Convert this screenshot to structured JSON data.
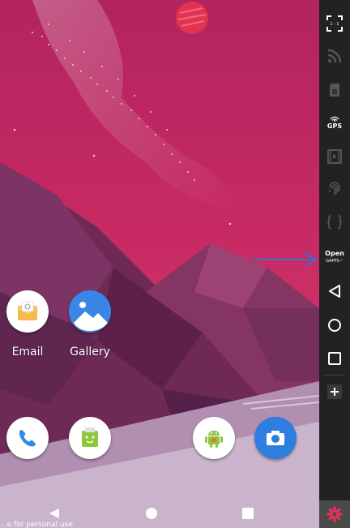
{
  "home": {
    "apps": [
      {
        "name": "Email",
        "icon": "email-envelope-icon"
      },
      {
        "name": "Gallery",
        "icon": "gallery-mountain-icon"
      }
    ],
    "dock": [
      {
        "icon": "phone-icon"
      },
      {
        "icon": "messaging-icon"
      },
      {
        "icon": "android-icon"
      },
      {
        "icon": "camera-icon"
      }
    ]
  },
  "navbar": {
    "buttons": [
      "back-icon",
      "home-icon",
      "recents-icon"
    ]
  },
  "watermark": "...e for personal use",
  "sidebar": {
    "fullscreen_label": "1 : 1",
    "gps_label": "GPS",
    "opengapps_label": "Open",
    "opengapps_sub": "GAPPS",
    "items": [
      "fullscreen-icon",
      "wifi-signal-icon",
      "sim-icon",
      "gps-icon",
      "media-icon",
      "fingerprint-icon",
      "braces-icon",
      "opengapps-icon",
      "back-icon",
      "home-icon",
      "recents-icon",
      "add-icon",
      "settings-icon"
    ]
  },
  "colors": {
    "sidebar_bg": "#222222",
    "settings_accent": "#e8315a",
    "arrow": "#3a6fd8"
  }
}
